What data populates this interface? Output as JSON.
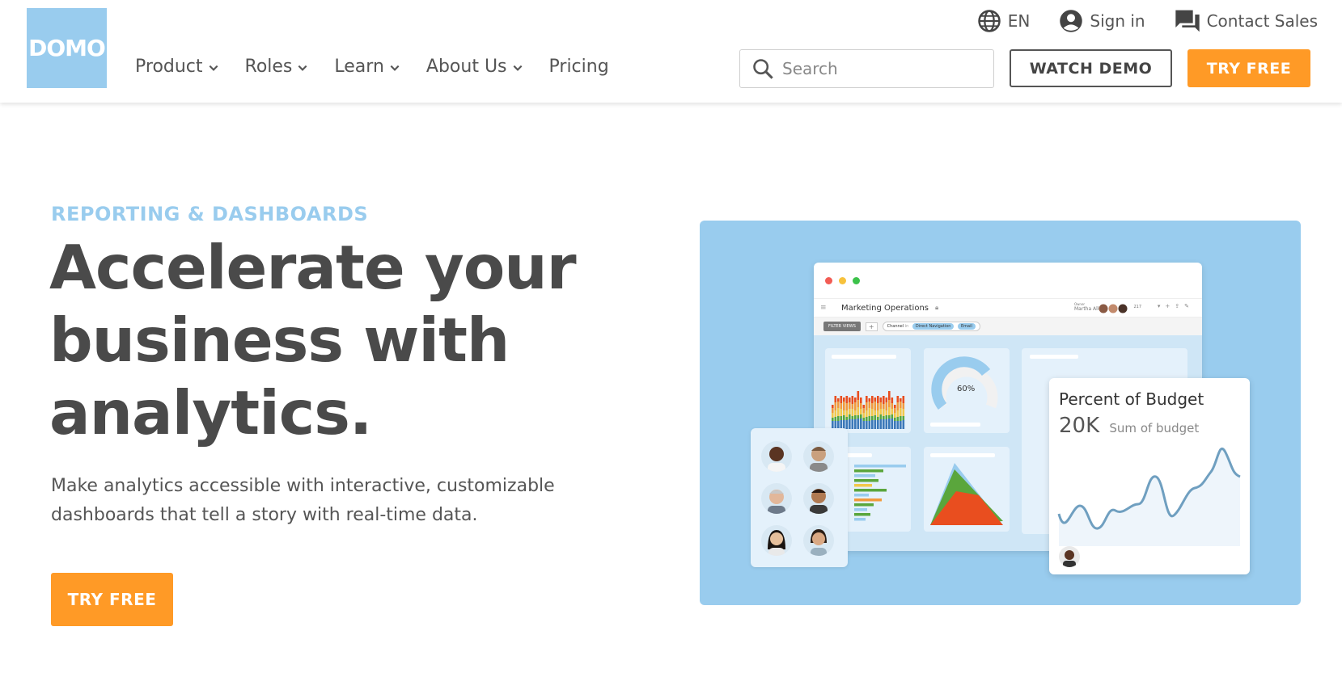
{
  "brand": {
    "logo_text": "DOMO",
    "color": "#99ccee",
    "accent": "#ff9a26"
  },
  "utility": {
    "language": "EN",
    "sign_in": "Sign in",
    "contact": "Contact Sales"
  },
  "nav": {
    "items": [
      {
        "label": "Product",
        "has_dropdown": true
      },
      {
        "label": "Roles",
        "has_dropdown": true
      },
      {
        "label": "Learn",
        "has_dropdown": true
      },
      {
        "label": "About Us",
        "has_dropdown": true
      },
      {
        "label": "Pricing",
        "has_dropdown": false
      }
    ]
  },
  "search": {
    "placeholder": "Search",
    "value": ""
  },
  "buttons": {
    "watch_demo": "WATCH DEMO",
    "try_free": "TRY FREE"
  },
  "hero": {
    "eyebrow": "REPORTING & DASHBOARDS",
    "headline": "Accelerate your business with analytics.",
    "subtext": "Make analytics accessible with interactive, customizable dashboards that tell a story with real-time data.",
    "cta": "TRY FREE"
  },
  "illustration": {
    "window_title": "Marketing Operations",
    "owner_label": "Owner",
    "owner_name": "Martha Allen",
    "follower_count": "217",
    "filter_label": "FILTER VIEWS",
    "chip_label": "Channel",
    "chip_in": "in",
    "chip_values": [
      "Direct Navigation",
      "Email"
    ],
    "gauge_value": "60%",
    "budget_title": "Percent of Budget",
    "budget_value": "20K",
    "budget_caption": "Sum of budget"
  }
}
